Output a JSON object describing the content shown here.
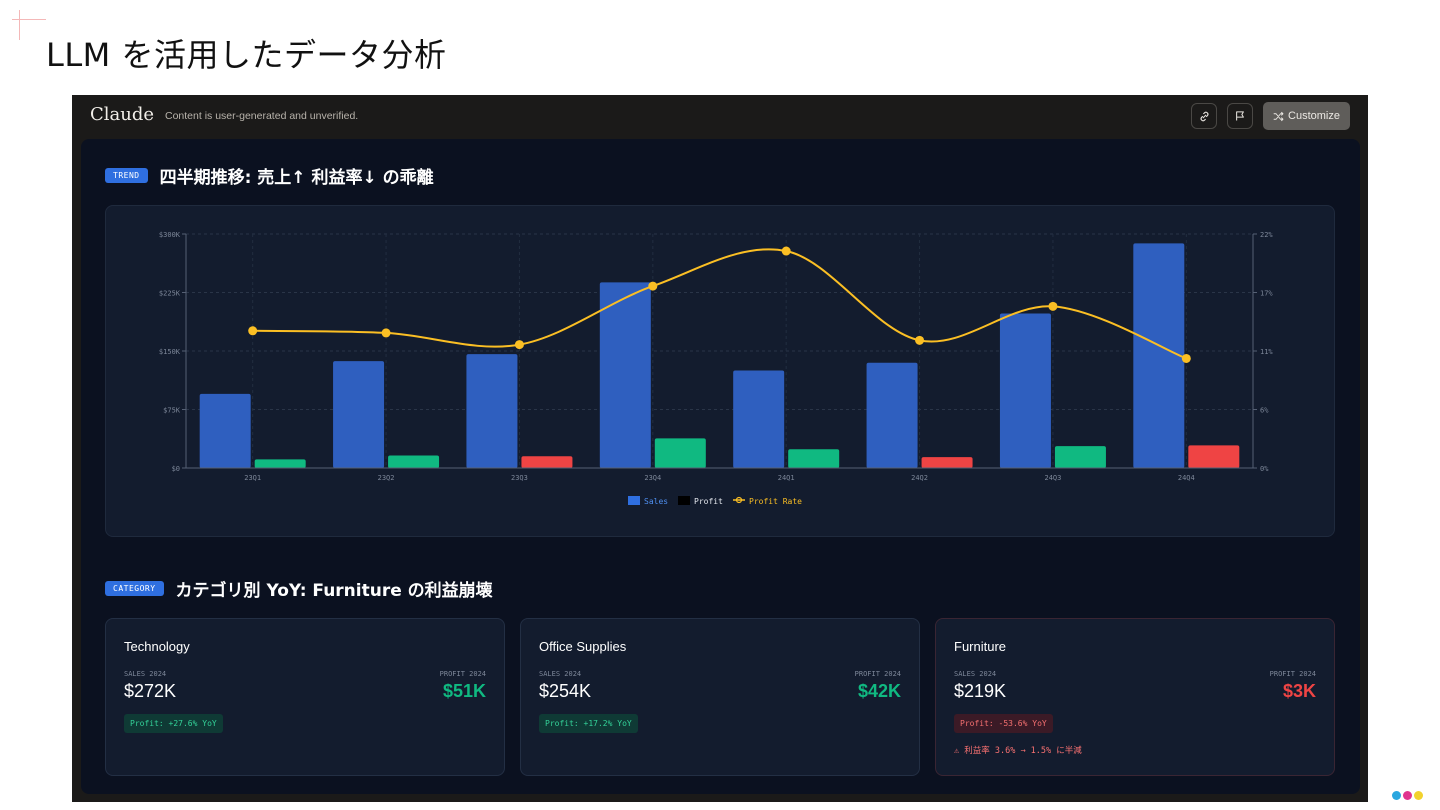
{
  "slide": {
    "title": "LLM を活用したデータ分析"
  },
  "app": {
    "brand": "Claude",
    "disclaimer": "Content is user-generated and unverified.",
    "customize_label": "Customize",
    "icons": [
      "link-icon",
      "flag-icon",
      "shuffle-icon"
    ]
  },
  "trend": {
    "tag": "TREND",
    "title": "四半期推移: 売上↑ 利益率↓ の乖離"
  },
  "chart_data": {
    "type": "bar",
    "categories": [
      "23Q1",
      "23Q2",
      "23Q3",
      "23Q4",
      "24Q1",
      "24Q2",
      "24Q3",
      "24Q4"
    ],
    "series": [
      {
        "name": "Sales",
        "axis": "left",
        "color": "#2f5fbf",
        "values": [
          95000,
          137000,
          146000,
          238000,
          125000,
          135000,
          198000,
          288000
        ]
      },
      {
        "name": "Profit",
        "axis": "left",
        "color_positive": "#10b981",
        "color_negative": "#ef4444",
        "values": [
          11000,
          16000,
          -15000,
          38000,
          24000,
          -14000,
          28000,
          -29000
        ]
      },
      {
        "name": "Profit Rate",
        "axis": "right",
        "type": "line",
        "color": "#fbbf24",
        "values": [
          12.9,
          12.7,
          11.6,
          17.1,
          20.4,
          12.0,
          15.2,
          10.3
        ]
      }
    ],
    "y_left": {
      "range": [
        0,
        300000
      ],
      "ticks": [
        "$0",
        "$75K",
        "$150K",
        "$225K",
        "$300K"
      ]
    },
    "y_right": {
      "range": [
        0,
        22
      ],
      "ticks": [
        "0%",
        "6%",
        "11%",
        "17%",
        "22%"
      ]
    },
    "grid": true,
    "legend": {
      "position": "bottom-center",
      "labels": [
        "Sales",
        "Profit",
        "Profit Rate"
      ]
    }
  },
  "category": {
    "tag": "CATEGORY",
    "title": "カテゴリ別 YoY: Furniture の利益崩壊",
    "sales_label": "SALES 2024",
    "profit_label": "PROFIT 2024",
    "cards": [
      {
        "name": "Technology",
        "sales": "$272K",
        "profit": "$51K",
        "yoy": "Profit: +27.6% YoY",
        "status": "good",
        "note": ""
      },
      {
        "name": "Office Supplies",
        "sales": "$254K",
        "profit": "$42K",
        "yoy": "Profit: +17.2% YoY",
        "status": "good",
        "note": ""
      },
      {
        "name": "Furniture",
        "sales": "$219K",
        "profit": "$3K",
        "yoy": "Profit: -53.6% YoY",
        "status": "bad",
        "note": "⚠ 利益率 3.6% → 1.5% に半減"
      }
    ]
  },
  "colors": {
    "good": "#10b981",
    "bad": "#ef4444",
    "accent": "#2f6fe0"
  }
}
